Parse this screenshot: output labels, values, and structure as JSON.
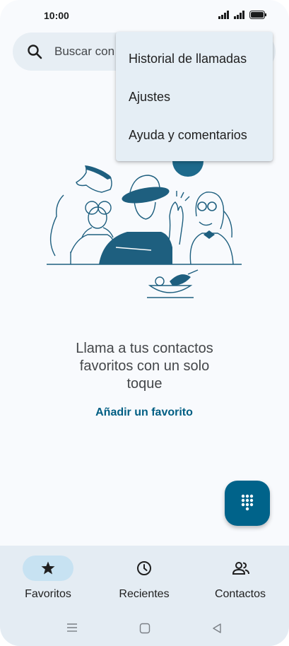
{
  "status_bar": {
    "time": "10:00"
  },
  "search": {
    "placeholder": "Buscar con"
  },
  "overflow_menu": {
    "items": [
      {
        "label": "Historial de llamadas"
      },
      {
        "label": "Ajustes"
      },
      {
        "label": "Ayuda y comentarios"
      }
    ]
  },
  "empty_state": {
    "message_line1": "Llama a tus contactos",
    "message_line2": "favoritos con un solo",
    "message_line3": "toque",
    "action_label": "Añadir un favorito"
  },
  "bottom_nav": {
    "items": [
      {
        "label": "Favoritos",
        "icon": "star-icon",
        "active": true
      },
      {
        "label": "Recientes",
        "icon": "clock-icon",
        "active": false
      },
      {
        "label": "Contactos",
        "icon": "people-icon",
        "active": false
      }
    ]
  },
  "colors": {
    "accent": "#00638a",
    "link": "#005e83",
    "nav_background": "#e4ecf3",
    "active_pill": "#c7e2f2"
  }
}
